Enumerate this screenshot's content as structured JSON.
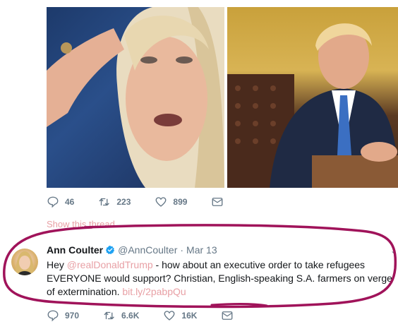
{
  "previous_tweet": {
    "actions": {
      "replies": "46",
      "retweets": "223",
      "likes": "899"
    },
    "show_thread": "Show this thread"
  },
  "tweet": {
    "author_name": "Ann Coulter",
    "handle": "@AnnCoulter",
    "separator": "·",
    "date": "Mar 13",
    "text_before": "Hey ",
    "mention": "@realDonaldTrump",
    "text_after": " - how about an executive order to take refugees EVERYONE would support?  Christian, English-speaking S.A. farmers on verge of extermination. ",
    "link": "bit.ly/2pabpQu",
    "actions": {
      "replies": "970",
      "retweets": "6.6K",
      "likes": "16K"
    }
  },
  "icons": [
    "reply-icon",
    "retweet-icon",
    "like-icon",
    "message-icon",
    "verified-badge-icon",
    "caret-down-icon"
  ],
  "colors": {
    "accent_pink": "#e8a0a5",
    "muted": "#657786",
    "verified_blue": "#1da1f2",
    "marker_magenta": "#a0135a"
  }
}
